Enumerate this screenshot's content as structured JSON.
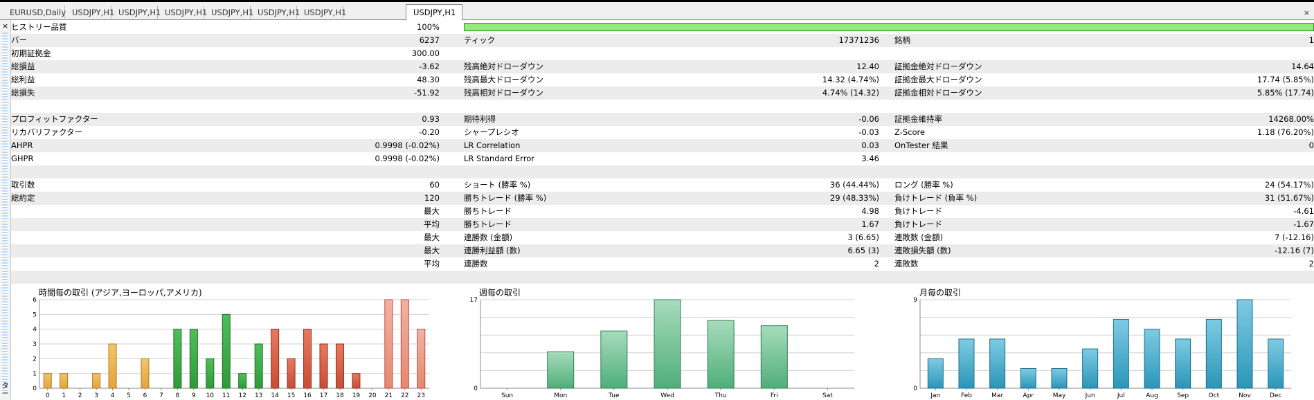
{
  "tabs": [
    "EURUSD,Daily",
    "USDJPY,H1",
    "USDJPY,H1",
    "USDJPY,H1",
    "USDJPY,H1",
    "USDJPY,H1",
    "USDJPY,H1",
    "USDJPY,H1"
  ],
  "active_tab": 7,
  "tab_close": "×",
  "side_close": "×",
  "side_label": "ター",
  "report": {
    "history_quality": {
      "label": "ヒストリー品質",
      "value": "100%"
    },
    "rows": [
      {
        "shade": true,
        "cells": [
          "バー",
          "6237",
          "ティック",
          "17371236",
          "銘柄",
          "1"
        ]
      },
      {
        "shade": false,
        "cells": [
          "初期証拠金",
          "300.00",
          "",
          "",
          "",
          ""
        ]
      },
      {
        "shade": true,
        "cells": [
          "総損益",
          "-3.62",
          "残高絶対ドローダウン",
          "12.40",
          "証拠金絶対ドローダウン",
          "14.64"
        ]
      },
      {
        "shade": false,
        "cells": [
          "総利益",
          "48.30",
          "残高最大ドローダウン",
          "14.32 (4.74%)",
          "証拠金最大ドローダウン",
          "17.74 (5.85%)"
        ]
      },
      {
        "shade": true,
        "cells": [
          "総損失",
          "-51.92",
          "残高相対ドローダウン",
          "4.74% (14.32)",
          "証拠金相対ドローダウン",
          "5.85% (17.74)"
        ]
      },
      {
        "shade": false,
        "cells": [
          "",
          "",
          "",
          "",
          "",
          ""
        ]
      },
      {
        "shade": true,
        "cells": [
          "プロフィットファクター",
          "0.93",
          "期待利得",
          "-0.06",
          "証拠金維持率",
          "14268.00%"
        ]
      },
      {
        "shade": false,
        "cells": [
          "リカバリファクター",
          "-0.20",
          "シャープレシオ",
          "-0.03",
          "Z-Score",
          "1.18 (76.20%)"
        ]
      },
      {
        "shade": true,
        "cells": [
          "AHPR",
          "0.9998 (-0.02%)",
          "LR Correlation",
          "0.03",
          "OnTester 結果",
          "0"
        ]
      },
      {
        "shade": false,
        "cells": [
          "GHPR",
          "0.9998 (-0.02%)",
          "LR Standard Error",
          "3.46",
          "",
          ""
        ]
      },
      {
        "shade": true,
        "cells": [
          "",
          "",
          "",
          "",
          "",
          ""
        ]
      },
      {
        "shade": false,
        "cells": [
          "取引数",
          "60",
          "ショート (勝率 %)",
          "36 (44.44%)",
          "ロング (勝率 %)",
          "24 (54.17%)"
        ]
      },
      {
        "shade": true,
        "cells": [
          "総約定",
          "120",
          "勝ちトレード (勝率 %)",
          "29 (48.33%)",
          "負けトレード (負率 %)",
          "31 (51.67%)"
        ]
      },
      {
        "shade": false,
        "cells": [
          "",
          "最大",
          "勝ちトレード",
          "4.98",
          "負けトレード",
          "-4.61"
        ]
      },
      {
        "shade": true,
        "cells": [
          "",
          "平均",
          "勝ちトレード",
          "1.67",
          "負けトレード",
          "-1.67"
        ]
      },
      {
        "shade": false,
        "cells": [
          "",
          "最大",
          "連勝数 (金額)",
          "3 (6.65)",
          "連敗数 (金額)",
          "7 (-12.16)"
        ]
      },
      {
        "shade": true,
        "cells": [
          "",
          "最大",
          "連勝利益額 (数)",
          "6.65 (3)",
          "連敗損失額 (数)",
          "-12.16 (7)"
        ]
      },
      {
        "shade": false,
        "cells": [
          "",
          "平均",
          "連勝数",
          "2",
          "連敗数",
          "2"
        ]
      },
      {
        "shade": true,
        "cells": [
          "",
          "",
          "",
          "",
          "",
          ""
        ]
      }
    ]
  },
  "chart_data": [
    {
      "type": "bar",
      "title": "時間毎の取引 (アジア,ヨーロッパ,アメリカ)",
      "categories": [
        "0",
        "1",
        "2",
        "3",
        "4",
        "5",
        "6",
        "7",
        "8",
        "9",
        "10",
        "11",
        "12",
        "13",
        "14",
        "15",
        "16",
        "17",
        "18",
        "19",
        "20",
        "21",
        "22",
        "23"
      ],
      "values": [
        1,
        1,
        0,
        1,
        3,
        0,
        2,
        0,
        4,
        4,
        2,
        5,
        1,
        3,
        4,
        2,
        4,
        3,
        3,
        1,
        0,
        6,
        6,
        4
      ],
      "yticks": [
        "0",
        "1",
        "2",
        "3",
        "4",
        "5",
        "6"
      ],
      "ylim": [
        0,
        6
      ],
      "colors": {
        "asia": "#e3a43a",
        "europe": "#2f9a3a",
        "america": "#cc4b34",
        "late": "#e28a6e",
        "late_edge": "#c8403a"
      }
    },
    {
      "type": "bar",
      "title": "週毎の取引",
      "categories": [
        "Sun",
        "Mon",
        "Tue",
        "Wed",
        "Thu",
        "Fri",
        "Sat"
      ],
      "values": [
        0,
        7,
        11,
        17,
        13,
        12,
        0
      ],
      "yticks": [
        "0",
        "17"
      ],
      "ylim": [
        0,
        17
      ],
      "colors": {
        "fill": "#4fae7a",
        "edge": "#2f7f55"
      }
    },
    {
      "type": "bar",
      "title": "月毎の取引",
      "categories": [
        "Jan",
        "Feb",
        "Mar",
        "Apr",
        "May",
        "Jun",
        "Jul",
        "Aug",
        "Sep",
        "Oct",
        "Nov",
        "Dec"
      ],
      "values": [
        3,
        5,
        5,
        2,
        2,
        4,
        7,
        6,
        5,
        7,
        9,
        5
      ],
      "yticks": [
        "0",
        "9"
      ],
      "ylim": [
        0,
        9
      ],
      "colors": {
        "fill": "#2a96b8",
        "edge": "#1c6e8a"
      }
    }
  ]
}
